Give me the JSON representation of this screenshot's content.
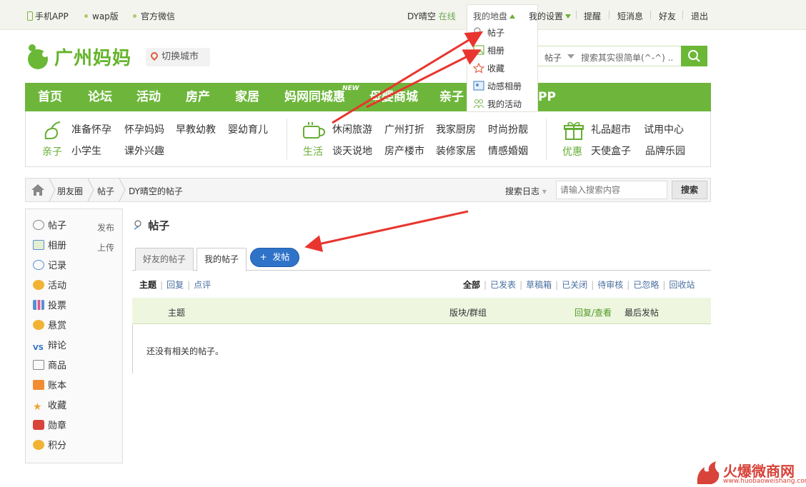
{
  "topbar": {
    "mobile_app": "手机APP",
    "wap": "wap版",
    "wechat": "官方微信",
    "username": "DY晴空",
    "status": "在线",
    "my_disk": "我的地盘",
    "my_settings": "我的设置",
    "remind": "提醒",
    "messages": "短消息",
    "friends": "好友",
    "logout": "退出"
  },
  "dropdown": {
    "items": [
      "帖子",
      "相册",
      "收藏",
      "动感相册",
      "我的活动"
    ]
  },
  "logo": {
    "text": "广州妈妈"
  },
  "city": {
    "label": "切换城市"
  },
  "search": {
    "type": "帖子",
    "placeholder": "搜索其实很简单(^-^) .."
  },
  "mainnav": {
    "items": [
      "首页",
      "论坛",
      "活动",
      "房产",
      "家居",
      "妈网同城惠",
      "母婴商城",
      "亲子",
      "PP"
    ],
    "new_badge": "NEW"
  },
  "subnav": {
    "group1": {
      "category": "亲子",
      "links": [
        "准备怀孕",
        "怀孕妈妈",
        "早教幼教",
        "婴幼育儿",
        "小学生",
        "课外兴趣"
      ]
    },
    "group2": {
      "category": "生活",
      "links": [
        "休闲旅游",
        "广州打折",
        "我家厨房",
        "时尚扮靓",
        "谈天说地",
        "房产楼市",
        "装修家居",
        "情感婚姻"
      ]
    },
    "group3": {
      "category": "优惠",
      "links": [
        "礼品超市",
        "试用中心",
        "天使盒子",
        "品牌乐园"
      ]
    }
  },
  "breadcrumb": {
    "items": [
      "朋友圈",
      "帖子",
      "DY晴空的帖子"
    ],
    "log_search": "搜索日志",
    "search_placeholder": "请输入搜索内容",
    "search_button": "搜索"
  },
  "sidebar": {
    "items": [
      {
        "label": "帖子",
        "action": "发布"
      },
      {
        "label": "相册",
        "action": "上传"
      },
      {
        "label": "记录"
      },
      {
        "label": "活动"
      },
      {
        "label": "投票"
      },
      {
        "label": "悬赏"
      },
      {
        "label": "辩论"
      },
      {
        "label": "商品"
      },
      {
        "label": "账本"
      },
      {
        "label": "收藏"
      },
      {
        "label": "勋章"
      },
      {
        "label": "积分"
      }
    ]
  },
  "content": {
    "title": "帖子",
    "tabs": [
      "好友的帖子",
      "我的帖子"
    ],
    "post_button": "发帖",
    "filter_left": [
      "主题",
      "回复",
      "点评"
    ],
    "filter_right": [
      "全部",
      "已发表",
      "草稿箱",
      "已关闭",
      "待审核",
      "已忽略",
      "回收站"
    ],
    "columns": [
      "主题",
      "版块/群组",
      "回复/查看",
      "最后发帖"
    ],
    "empty": "还没有相关的帖子。"
  },
  "watermark": {
    "text": "火爆微商网",
    "url": "www.huobaoweishang.com"
  },
  "colors": {
    "brand_green": "#6db63b",
    "arrow_red": "#e8352e",
    "post_blue": "#2f73c9"
  }
}
